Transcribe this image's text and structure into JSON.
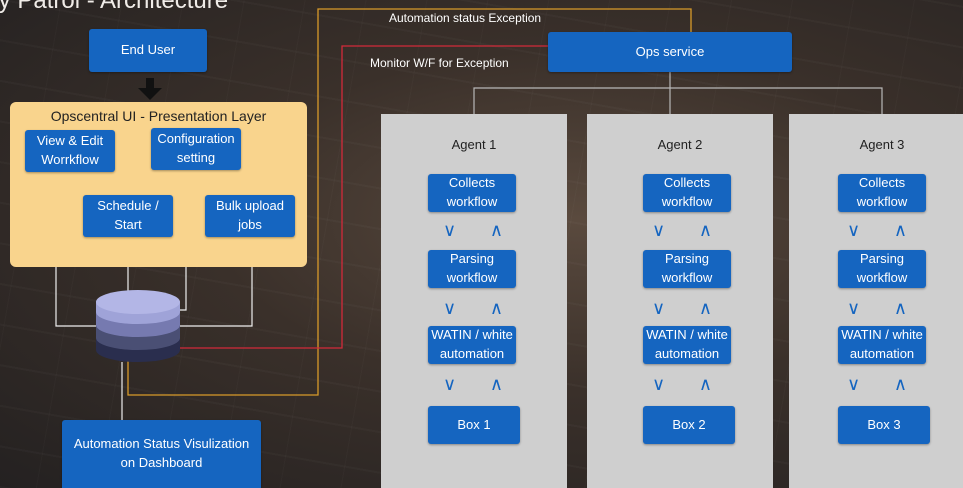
{
  "title": "ty Patrol - Architecture",
  "end_user": "End User",
  "ui_layer": {
    "title": "Opscentral UI - Presentation Layer",
    "view_edit": "View & Edit Worrkflow",
    "configuration": "Configuration setting",
    "schedule": "Schedule / Start",
    "bulk_upload": "Bulk upload jobs"
  },
  "dashboard": "Automation Status Visulization on Dashboard",
  "ops_service": "Ops service",
  "connections": {
    "automation_status_exception": "Automation status Exception",
    "monitor_exception": "Monitor W/F for Exception"
  },
  "agents": [
    {
      "title": "Agent 1",
      "collects": "Collects workflow",
      "parsing": "Parsing workflow",
      "watin": "WATIN / white automation",
      "box": "Box 1"
    },
    {
      "title": "Agent 2",
      "collects": "Collects workflow",
      "parsing": "Parsing workflow",
      "watin": "WATIN / white automation",
      "box": "Box 2"
    },
    {
      "title": "Agent 3",
      "collects": "Collects workflow",
      "parsing": "Parsing workflow",
      "watin": "WATIN / white automation",
      "box": "Box 3"
    }
  ],
  "arrow_glyphs": {
    "down": "∨",
    "up": "∧"
  },
  "colors": {
    "blue_box": "#1565c0",
    "ui_panel": "#f9d48d",
    "agent_panel": "#cfcfcf",
    "orange_line": "#d89a2a",
    "red_line": "#d22a3a"
  },
  "icons": [
    "down-arrow-icon",
    "database-icon"
  ]
}
